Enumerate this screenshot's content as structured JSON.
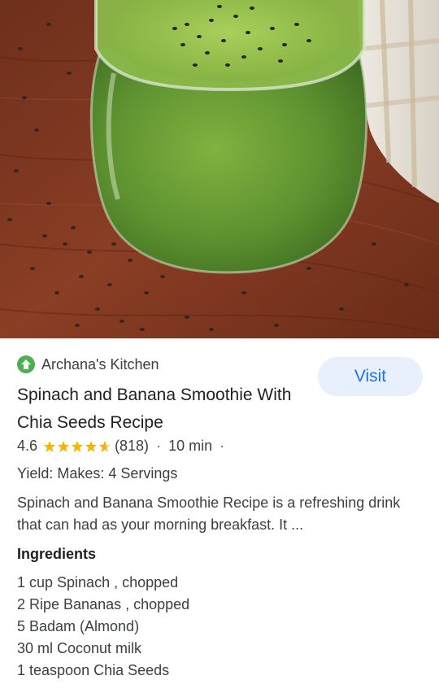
{
  "hero_image": {
    "icon": "green-smoothie-jar-photo"
  },
  "source": {
    "name": "Archana's Kitchen",
    "icon": "site-favicon-icon",
    "icon_color": "#4caf50"
  },
  "visit_button": {
    "label": "Visit",
    "bg_color": "#e8f0fe",
    "text_color": "#1a73e8"
  },
  "recipe": {
    "title": "Spinach and Banana Smoothie With Chia Seeds Recipe",
    "rating": "4.6",
    "rating_value": 4.6,
    "rating_max": 5,
    "review_count": "(818)",
    "separator": "·",
    "time": "10 min",
    "trailing_separator": "·",
    "yield": "Yield: Makes: 4 Servings",
    "description": "Spinach and Banana Smoothie Recipe is a refreshing drink that can had as your morning breakfast. It ...",
    "star_color": "#f4b400"
  },
  "ingredients": {
    "heading": "Ingredients",
    "items": [
      "1 cup Spinach , chopped",
      "2 Ripe Bananas , chopped",
      "5 Badam (Almond)",
      "30 ml Coconut milk",
      "1 teaspoon Chia Seeds"
    ]
  }
}
